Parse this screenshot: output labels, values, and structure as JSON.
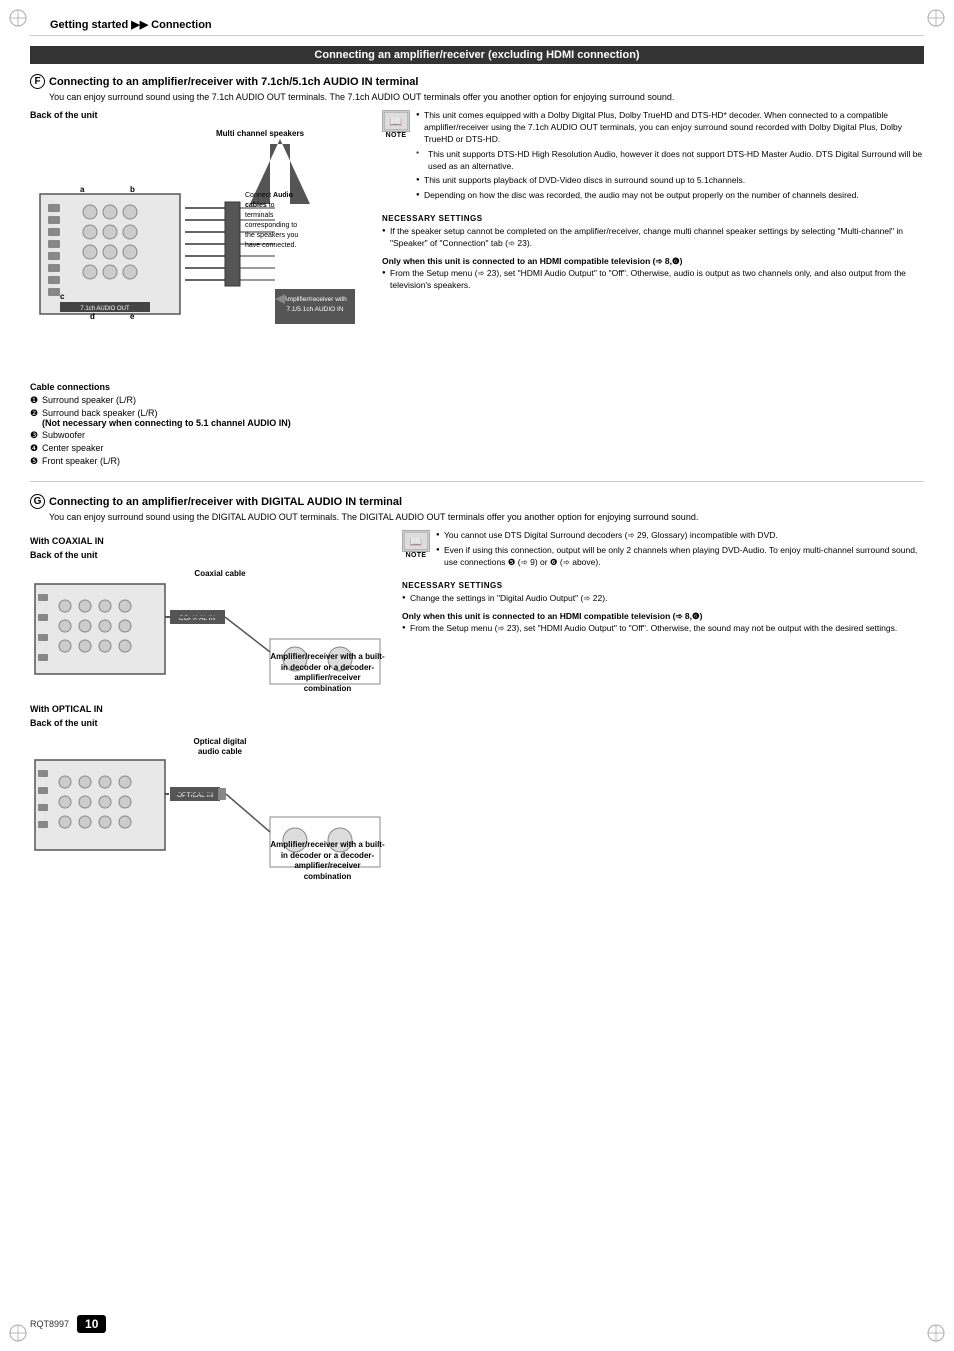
{
  "page": {
    "header": {
      "title": "Getting started",
      "arrows": "▶▶",
      "subtitle": "Connection"
    },
    "footer": {
      "model": "RQT8997",
      "page_number": "10"
    }
  },
  "section_banner": {
    "text": "Connecting an amplifier/receiver (excluding HDMI connection)"
  },
  "section_f": {
    "letter": "F",
    "title": "Connecting to an amplifier/receiver with 7.1ch/5.1ch AUDIO IN terminal",
    "desc": "You can enjoy surround sound using the 7.1ch AUDIO OUT terminals. The 7.1ch AUDIO OUT terminals offer you another option for enjoying surround sound.",
    "back_label": "Back of the unit",
    "mc_speakers_label": "Multi channel speakers",
    "connect_text_bold": "Audio cables",
    "connect_text1": "Connect ",
    "connect_text2": " to terminals corresponding to the speakers you have connected.",
    "amp_receiver_label": "Amplifier/receiver with\n7.1/5.1ch AUDIO IN",
    "cable_connections": {
      "title": "Cable connections",
      "items": [
        {
          "bullet": "❶",
          "text": "Surround speaker (L/R)"
        },
        {
          "bullet": "❷",
          "text": "Surround back speaker (L/R)",
          "bold_note": "(Not necessary when connecting to 5.1 channel AUDIO IN)"
        },
        {
          "bullet": "❸",
          "text": "Subwoofer"
        },
        {
          "bullet": "❹",
          "text": "Center speaker"
        },
        {
          "bullet": "❺",
          "text": "Front speaker (L/R)"
        }
      ]
    },
    "note": {
      "items": [
        "This unit comes equipped with a Dolby Digital Plus, Dolby TrueHD and DTS-HD* decoder. When connected to a compatible amplifier/receiver using the 7.1ch AUDIO OUT terminals, you can enjoy surround sound recorded with Dolby Digital Plus, Dolby TrueHD or DTS-HD.",
        "*This unit supports DTS-HD High Resolution Audio, however it does not support DTS-HD Master Audio. DTS Digital Surround will be used as an alternative.",
        "This unit supports playback of DVD-Video discs in surround sound up to 5.1channels.",
        "Depending on how the disc was recorded, the audio may not be output properly on the number of channels desired."
      ]
    },
    "nec_settings": {
      "title": "NECESSARY SETTINGS",
      "items": [
        "If the speaker setup cannot be completed on the amplifier/receiver, change multi channel speaker settings by selecting \"Multi-channel\" in \"Speaker\" of \"Connection\" tab (➾ 23)."
      ]
    },
    "only_when": {
      "title": "Only when this unit is connected to an HDMI compatible television",
      "ref": "(➾ 8,❻)",
      "items": [
        "From the Setup menu (➾ 23), set \"HDMI Audio Output\" to \"Off\". Otherwise, audio is output as two channels only, and also output from the television's speakers."
      ]
    }
  },
  "section_g": {
    "letter": "G",
    "title": "Connecting to an amplifier/receiver with DIGITAL AUDIO IN terminal",
    "desc": "You can enjoy surround sound using the DIGITAL AUDIO OUT terminals. The DIGITAL AUDIO OUT terminals offer you another option for enjoying surround sound.",
    "coaxial": {
      "with_label": "With COAXIAL IN",
      "back_label": "Back of the unit",
      "cable_label": "Coaxial cable",
      "amp_label": "Amplifier/receiver with a built-in decoder or a decoder-amplifier/receiver combination"
    },
    "optical": {
      "with_label": "With OPTICAL IN",
      "back_label": "Back of the unit",
      "cable_label": "Optical digital\naudio cable",
      "amp_label": "Amplifier/receiver with a built-in decoder or a decoder-amplifier/receiver combination"
    },
    "note": {
      "items": [
        "You cannot use DTS Digital Surround decoders (➾ 29, Glossary) incompatible with DVD.",
        "Even if using this connection, output will be only 2 channels when playing DVD-Audio. To enjoy multi-channel surround sound, use connections ❺ (➾ 9) or ❻ (➾ above)."
      ]
    },
    "nec_settings": {
      "title": "NECESSARY SETTINGS",
      "items": [
        "Change the settings in \"Digital Audio Output\" (➾ 22)."
      ]
    },
    "only_when": {
      "title": "Only when this unit is connected to an HDMI compatible television",
      "ref": "(➾ 8,❻)",
      "items": [
        "From the Setup menu (➾ 23), set \"HDMI Audio Output\" to \"Off\". Otherwise, the sound may not be output with the desired settings."
      ]
    }
  }
}
